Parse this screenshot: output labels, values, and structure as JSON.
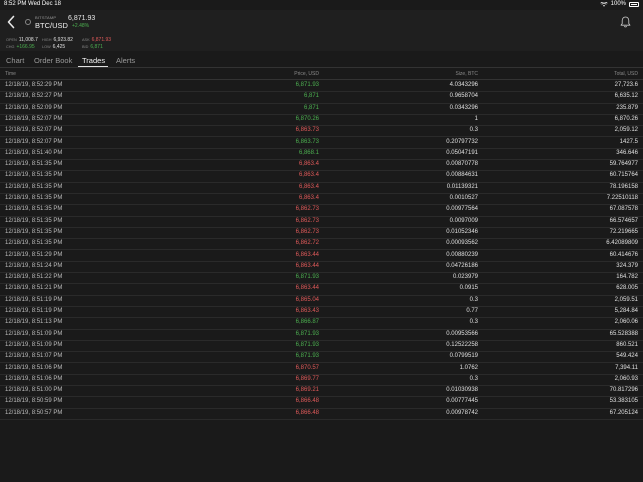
{
  "status_bar": {
    "time_date": "8:52 PM  Wed Dec 18",
    "battery": "100%"
  },
  "header": {
    "exchange": "BITSTAMP",
    "pair": "BTC/USD",
    "price": "6,871.93",
    "change": "+2.48%"
  },
  "stats": [
    {
      "key": "OPEN",
      "value": "11,008.7",
      "tone": "white"
    },
    {
      "key": "HIGH",
      "value": "6,923.82",
      "tone": "white"
    },
    {
      "key": "ASK",
      "value": "6,871.93",
      "tone": "red"
    },
    {
      "key": "CHG",
      "value": "+166.95",
      "tone": "green"
    },
    {
      "key": "LOW",
      "value": "6,425",
      "tone": "white"
    },
    {
      "key": "BID",
      "value": "6,871",
      "tone": "green"
    }
  ],
  "tabs": [
    {
      "label": "Chart",
      "active": false
    },
    {
      "label": "Order Book",
      "active": false
    },
    {
      "label": "Trades",
      "active": true
    },
    {
      "label": "Alerts",
      "active": false
    }
  ],
  "columns": {
    "time": "Time",
    "price": "Price, USD",
    "size": "Size, BTC",
    "total": "Total, USD"
  },
  "trades": [
    {
      "time": "12/18/19, 8:52:29 PM",
      "price": "6,871.93",
      "dir": "up",
      "size": "4.0343296",
      "total": "27,723.6"
    },
    {
      "time": "12/18/19, 8:52:27 PM",
      "price": "6,871",
      "dir": "up",
      "size": "0.9658704",
      "total": "6,635.12"
    },
    {
      "time": "12/18/19, 8:52:09 PM",
      "price": "6,871",
      "dir": "up",
      "size": "0.0343296",
      "total": "235.879"
    },
    {
      "time": "12/18/19, 8:52:07 PM",
      "price": "6,870.26",
      "dir": "up",
      "size": "1",
      "total": "6,870.26"
    },
    {
      "time": "12/18/19, 8:52:07 PM",
      "price": "6,863.73",
      "dir": "down",
      "size": "0.3",
      "total": "2,059.12"
    },
    {
      "time": "12/18/19, 8:52:07 PM",
      "price": "6,863.73",
      "dir": "up",
      "size": "0.20797732",
      "total": "1427.5"
    },
    {
      "time": "12/18/19, 8:51:40 PM",
      "price": "6,868.1",
      "dir": "up",
      "size": "0.05047191",
      "total": "346.646"
    },
    {
      "time": "12/18/19, 8:51:35 PM",
      "price": "6,863.4",
      "dir": "down",
      "size": "0.00870778",
      "total": "59.764977"
    },
    {
      "time": "12/18/19, 8:51:35 PM",
      "price": "6,863.4",
      "dir": "down",
      "size": "0.00884631",
      "total": "60.715764"
    },
    {
      "time": "12/18/19, 8:51:35 PM",
      "price": "6,863.4",
      "dir": "down",
      "size": "0.01139321",
      "total": "78.196158"
    },
    {
      "time": "12/18/19, 8:51:35 PM",
      "price": "6,863.4",
      "dir": "down",
      "size": "0.0010527",
      "total": "7.22510118"
    },
    {
      "time": "12/18/19, 8:51:35 PM",
      "price": "6,862.73",
      "dir": "down",
      "size": "0.00977564",
      "total": "67.087578"
    },
    {
      "time": "12/18/19, 8:51:35 PM",
      "price": "6,862.73",
      "dir": "down",
      "size": "0.0097009",
      "total": "66.574657"
    },
    {
      "time": "12/18/19, 8:51:35 PM",
      "price": "6,862.73",
      "dir": "down",
      "size": "0.01052346",
      "total": "72.219665"
    },
    {
      "time": "12/18/19, 8:51:35 PM",
      "price": "6,862.72",
      "dir": "down",
      "size": "0.00093562",
      "total": "6.42089809"
    },
    {
      "time": "12/18/19, 8:51:29 PM",
      "price": "6,863.44",
      "dir": "down",
      "size": "0.00880239",
      "total": "60.414676"
    },
    {
      "time": "12/18/19, 8:51:24 PM",
      "price": "6,863.44",
      "dir": "down",
      "size": "0.04726186",
      "total": "324.379"
    },
    {
      "time": "12/18/19, 8:51:22 PM",
      "price": "6,871.93",
      "dir": "up",
      "size": "0.023979",
      "total": "164.782"
    },
    {
      "time": "12/18/19, 8:51:21 PM",
      "price": "6,863.44",
      "dir": "down",
      "size": "0.0915",
      "total": "628.005"
    },
    {
      "time": "12/18/19, 8:51:19 PM",
      "price": "6,865.04",
      "dir": "down",
      "size": "0.3",
      "total": "2,059.51"
    },
    {
      "time": "12/18/19, 8:51:19 PM",
      "price": "6,863.43",
      "dir": "down",
      "size": "0.77",
      "total": "5,284.84"
    },
    {
      "time": "12/18/19, 8:51:13 PM",
      "price": "6,866.87",
      "dir": "up",
      "size": "0.3",
      "total": "2,060.06"
    },
    {
      "time": "12/18/19, 8:51:09 PM",
      "price": "6,871.93",
      "dir": "up",
      "size": "0.00953566",
      "total": "65.528388"
    },
    {
      "time": "12/18/19, 8:51:09 PM",
      "price": "6,871.93",
      "dir": "up",
      "size": "0.12522258",
      "total": "860.521"
    },
    {
      "time": "12/18/19, 8:51:07 PM",
      "price": "6,871.93",
      "dir": "up",
      "size": "0.0799519",
      "total": "549.424"
    },
    {
      "time": "12/18/19, 8:51:06 PM",
      "price": "6,870.57",
      "dir": "down",
      "size": "1.0762",
      "total": "7,394.11"
    },
    {
      "time": "12/18/19, 8:51:06 PM",
      "price": "6,869.77",
      "dir": "down",
      "size": "0.3",
      "total": "2,060.93"
    },
    {
      "time": "12/18/19, 8:51:00 PM",
      "price": "6,869.21",
      "dir": "down",
      "size": "0.01030938",
      "total": "70.817296"
    },
    {
      "time": "12/18/19, 8:50:59 PM",
      "price": "6,866.48",
      "dir": "down",
      "size": "0.00777445",
      "total": "53.383105"
    },
    {
      "time": "12/18/19, 8:50:57 PM",
      "price": "6,866.48",
      "dir": "down",
      "size": "0.00978742",
      "total": "67.205124"
    }
  ]
}
